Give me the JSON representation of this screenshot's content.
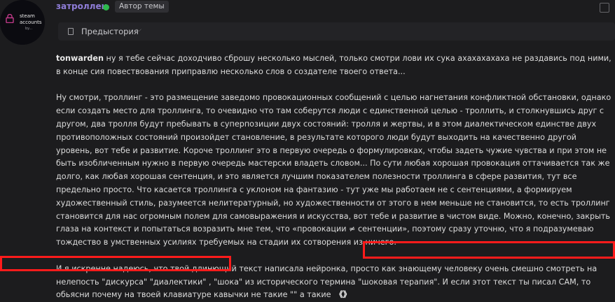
{
  "avatar": {
    "line1": "steam",
    "line2": "accounts",
    "line3": "by..."
  },
  "post_header": {
    "username": "затроллен",
    "badge": "Автор темы"
  },
  "prehistory": {
    "label": "Предыстория"
  },
  "post": {
    "mention": "tonwarden",
    "p1": " ну я тебе сейчас доходчиво сброшу несколько мыслей, только смотри лови их сука ахахахахаха не раздавись под ними, в конце сия повествования приправлю несколько слов о создателе твоего ответа...",
    "p2": "Ну смотри, троллинг - это размещение заведомо провокационных сообщений с целью нагнетания конфликтной обстановки, однако если создать место для троллинга, то очевидно что там соберутся люди с единственной целью - троллить, и столкнувшись друг с другом, два тролля будут пребывать в суперпозиции двух состояний: тролля и жертвы, и в этом диалектическом единстве двух противоположных состояний произойдет становление, в результате которого люди будут выходить на качественно другой уровень, вот тебе и развитие. Короче троллинг это в первую очередь о формулировках, чтобы задеть чужие чувства и при этом не быть изобличенным нужно в первую очередь мастерски владеть словом... По сути любая хорошая провокация оттачивается так же долго, как любая хорошая сентенция, и это является лучшим показателем полезности троллинга в сфере развития, тут все предельно просто. Что касается троллинга с уклоном на фантазию - тут уже мы работаем не с сентенциями, а формируем художественный стиль, разумеется нелитературный, но художественности от этого в нем меньше не становится, то есть троллинг становится для нас огромным полем для самовыражения и искусства, вот тебе и развитие в чистом виде. Можно, конечно, закрыть глаза на контекст и попытаться возразить мне тем, что «провокации ≠ сентенции», поэтому сразу уточню, что я подразумеваю тождество в умственных усилиях требуемых на стадии их сотворения из ничего.",
    "p3": "И я искренне надеюсь, что твой длинющий текст написала нейронка, просто как знающему человеку очень смешно смотреть на нелепость \"дискурса\" \"диалектики\" , \"шока\" из исторического термина \"шоковая терапия\". И если этот текст ты писал САМ, то обьясни почему на твоей клавиатуре кавычки не такие \"\" а такие",
    "quote_icon": "《》"
  },
  "icons": {
    "lock": "lock-icon",
    "doc": "document-icon",
    "chevron": "chevron-down-icon",
    "window": "square-icon"
  },
  "colors": {
    "username": "#8f7dd8",
    "online": "#2db84c",
    "highlight": "#ff1b1b"
  }
}
